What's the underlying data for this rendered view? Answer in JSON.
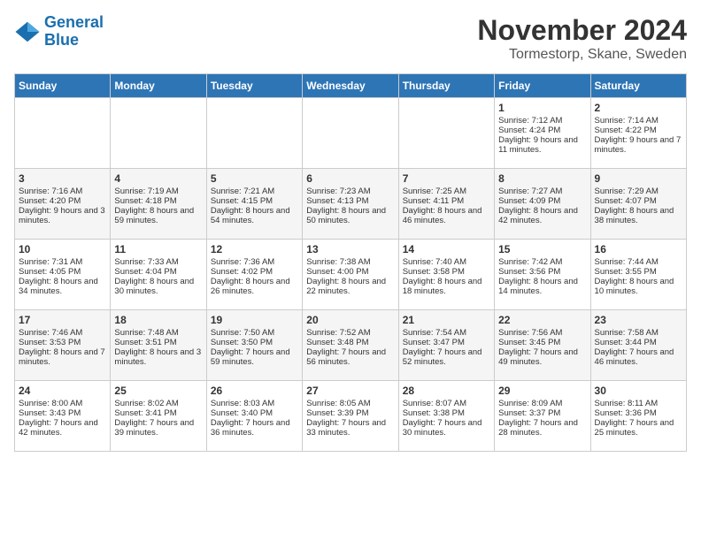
{
  "logo": {
    "line1": "General",
    "line2": "Blue"
  },
  "title": "November 2024",
  "subtitle": "Tormestorp, Skane, Sweden",
  "headers": [
    "Sunday",
    "Monday",
    "Tuesday",
    "Wednesday",
    "Thursday",
    "Friday",
    "Saturday"
  ],
  "weeks": [
    [
      {
        "day": "",
        "info": ""
      },
      {
        "day": "",
        "info": ""
      },
      {
        "day": "",
        "info": ""
      },
      {
        "day": "",
        "info": ""
      },
      {
        "day": "",
        "info": ""
      },
      {
        "day": "1",
        "info": "Sunrise: 7:12 AM\nSunset: 4:24 PM\nDaylight: 9 hours and 11 minutes."
      },
      {
        "day": "2",
        "info": "Sunrise: 7:14 AM\nSunset: 4:22 PM\nDaylight: 9 hours and 7 minutes."
      }
    ],
    [
      {
        "day": "3",
        "info": "Sunrise: 7:16 AM\nSunset: 4:20 PM\nDaylight: 9 hours and 3 minutes."
      },
      {
        "day": "4",
        "info": "Sunrise: 7:19 AM\nSunset: 4:18 PM\nDaylight: 8 hours and 59 minutes."
      },
      {
        "day": "5",
        "info": "Sunrise: 7:21 AM\nSunset: 4:15 PM\nDaylight: 8 hours and 54 minutes."
      },
      {
        "day": "6",
        "info": "Sunrise: 7:23 AM\nSunset: 4:13 PM\nDaylight: 8 hours and 50 minutes."
      },
      {
        "day": "7",
        "info": "Sunrise: 7:25 AM\nSunset: 4:11 PM\nDaylight: 8 hours and 46 minutes."
      },
      {
        "day": "8",
        "info": "Sunrise: 7:27 AM\nSunset: 4:09 PM\nDaylight: 8 hours and 42 minutes."
      },
      {
        "day": "9",
        "info": "Sunrise: 7:29 AM\nSunset: 4:07 PM\nDaylight: 8 hours and 38 minutes."
      }
    ],
    [
      {
        "day": "10",
        "info": "Sunrise: 7:31 AM\nSunset: 4:05 PM\nDaylight: 8 hours and 34 minutes."
      },
      {
        "day": "11",
        "info": "Sunrise: 7:33 AM\nSunset: 4:04 PM\nDaylight: 8 hours and 30 minutes."
      },
      {
        "day": "12",
        "info": "Sunrise: 7:36 AM\nSunset: 4:02 PM\nDaylight: 8 hours and 26 minutes."
      },
      {
        "day": "13",
        "info": "Sunrise: 7:38 AM\nSunset: 4:00 PM\nDaylight: 8 hours and 22 minutes."
      },
      {
        "day": "14",
        "info": "Sunrise: 7:40 AM\nSunset: 3:58 PM\nDaylight: 8 hours and 18 minutes."
      },
      {
        "day": "15",
        "info": "Sunrise: 7:42 AM\nSunset: 3:56 PM\nDaylight: 8 hours and 14 minutes."
      },
      {
        "day": "16",
        "info": "Sunrise: 7:44 AM\nSunset: 3:55 PM\nDaylight: 8 hours and 10 minutes."
      }
    ],
    [
      {
        "day": "17",
        "info": "Sunrise: 7:46 AM\nSunset: 3:53 PM\nDaylight: 8 hours and 7 minutes."
      },
      {
        "day": "18",
        "info": "Sunrise: 7:48 AM\nSunset: 3:51 PM\nDaylight: 8 hours and 3 minutes."
      },
      {
        "day": "19",
        "info": "Sunrise: 7:50 AM\nSunset: 3:50 PM\nDaylight: 7 hours and 59 minutes."
      },
      {
        "day": "20",
        "info": "Sunrise: 7:52 AM\nSunset: 3:48 PM\nDaylight: 7 hours and 56 minutes."
      },
      {
        "day": "21",
        "info": "Sunrise: 7:54 AM\nSunset: 3:47 PM\nDaylight: 7 hours and 52 minutes."
      },
      {
        "day": "22",
        "info": "Sunrise: 7:56 AM\nSunset: 3:45 PM\nDaylight: 7 hours and 49 minutes."
      },
      {
        "day": "23",
        "info": "Sunrise: 7:58 AM\nSunset: 3:44 PM\nDaylight: 7 hours and 46 minutes."
      }
    ],
    [
      {
        "day": "24",
        "info": "Sunrise: 8:00 AM\nSunset: 3:43 PM\nDaylight: 7 hours and 42 minutes."
      },
      {
        "day": "25",
        "info": "Sunrise: 8:02 AM\nSunset: 3:41 PM\nDaylight: 7 hours and 39 minutes."
      },
      {
        "day": "26",
        "info": "Sunrise: 8:03 AM\nSunset: 3:40 PM\nDaylight: 7 hours and 36 minutes."
      },
      {
        "day": "27",
        "info": "Sunrise: 8:05 AM\nSunset: 3:39 PM\nDaylight: 7 hours and 33 minutes."
      },
      {
        "day": "28",
        "info": "Sunrise: 8:07 AM\nSunset: 3:38 PM\nDaylight: 7 hours and 30 minutes."
      },
      {
        "day": "29",
        "info": "Sunrise: 8:09 AM\nSunset: 3:37 PM\nDaylight: 7 hours and 28 minutes."
      },
      {
        "day": "30",
        "info": "Sunrise: 8:11 AM\nSunset: 3:36 PM\nDaylight: 7 hours and 25 minutes."
      }
    ]
  ]
}
